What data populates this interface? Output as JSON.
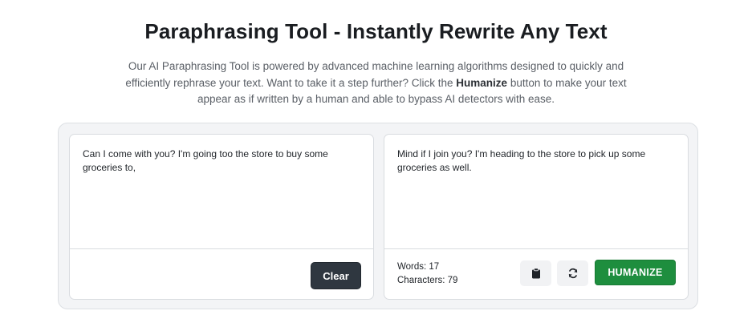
{
  "header": {
    "title": "Paraphrasing Tool - Instantly Rewrite Any Text",
    "description_before": "Our AI Paraphrasing Tool is powered by advanced machine learning algorithms designed to quickly and efficiently rephrase your text. Want to take it a step further? Click the ",
    "description_bold": "Humanize",
    "description_after": " button to make your text appear as if written by a human and able to bypass AI detectors with ease."
  },
  "input_panel": {
    "text": "Can I come with you? I'm going too the store to buy some groceries to,",
    "clear_label": "Clear"
  },
  "output_panel": {
    "text": "Mind if I join you? I'm heading to the store to pick up some groceries as well.",
    "words_label": "Words: 17",
    "characters_label": "Characters: 79",
    "copy_icon": "clipboard-icon",
    "refresh_icon": "refresh-icon",
    "humanize_label": "HUMANIZE"
  },
  "colors": {
    "humanize_button": "#1e8e3e",
    "clear_button": "#2f3740",
    "container_bg": "#f3f4f6"
  }
}
